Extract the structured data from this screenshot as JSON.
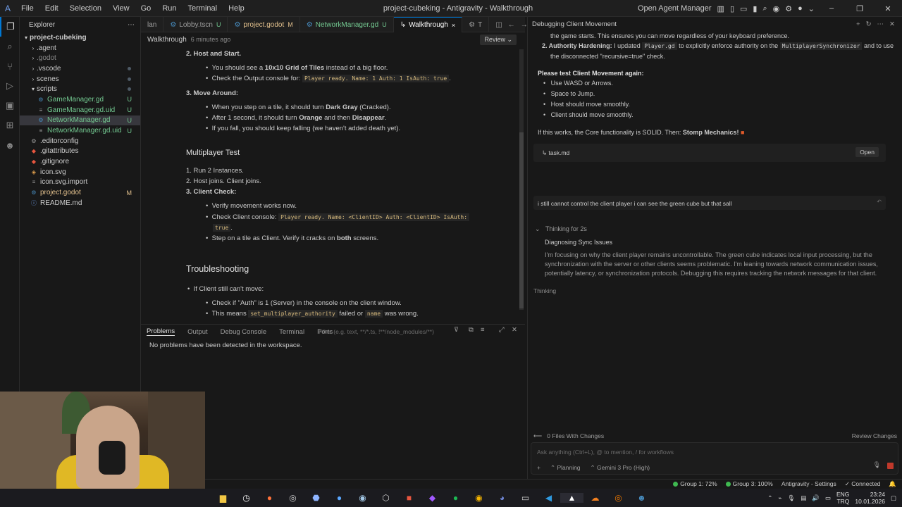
{
  "titlebar": {
    "menu": [
      "File",
      "Edit",
      "Selection",
      "View",
      "Go",
      "Run",
      "Terminal",
      "Help"
    ],
    "window_title": "project-cubeking - Antigravity - Walkthrough",
    "open_agent_manager": "Open Agent Manager"
  },
  "explorer": {
    "title": "Explorer",
    "root": "project-cubeking",
    "items": [
      {
        "name": ".agent",
        "indent": 1,
        "kind": "folder",
        "status": ""
      },
      {
        "name": ".godot",
        "indent": 1,
        "kind": "folder",
        "status": ""
      },
      {
        "name": ".vscode",
        "indent": 1,
        "kind": "folder",
        "status": "dot"
      },
      {
        "name": "scenes",
        "indent": 1,
        "kind": "folder",
        "status": "dot"
      },
      {
        "name": "scripts",
        "indent": 1,
        "kind": "folder-open",
        "status": "dot"
      },
      {
        "name": "GameManager.gd",
        "indent": 2,
        "kind": "gd",
        "status": "U"
      },
      {
        "name": "GameManager.gd.uid",
        "indent": 2,
        "kind": "uid",
        "status": "U"
      },
      {
        "name": "NetworkManager.gd",
        "indent": 2,
        "kind": "gd",
        "status": "U"
      },
      {
        "name": "NetworkManager.gd.uid",
        "indent": 2,
        "kind": "uid",
        "status": "U"
      },
      {
        "name": ".editorconfig",
        "indent": 1,
        "kind": "cfg",
        "status": ""
      },
      {
        "name": ".gitattributes",
        "indent": 1,
        "kind": "git",
        "status": ""
      },
      {
        "name": ".gitignore",
        "indent": 1,
        "kind": "git",
        "status": ""
      },
      {
        "name": "icon.svg",
        "indent": 1,
        "kind": "svg",
        "status": ""
      },
      {
        "name": "icon.svg.import",
        "indent": 1,
        "kind": "uid",
        "status": ""
      },
      {
        "name": "project.godot",
        "indent": 1,
        "kind": "godot",
        "status": "M"
      },
      {
        "name": "README.md",
        "indent": 1,
        "kind": "md",
        "status": ""
      }
    ]
  },
  "tabs": [
    {
      "label": "lan",
      "mark": ""
    },
    {
      "label": "Lobby.tscn",
      "mark": "U"
    },
    {
      "label": "project.godot",
      "mark": "M"
    },
    {
      "label": "NetworkManager.gd",
      "mark": "U"
    },
    {
      "label": "Walkthrough",
      "mark": "×"
    },
    {
      "label": "T",
      "mark": ""
    }
  ],
  "editor": {
    "breadcrumb": "Walkthrough",
    "time": "6 minutes ago",
    "review": "Review",
    "lines": {
      "l1": "2. Host and Start.",
      "l2a": "You should see a ",
      "l2b": "10x10 Grid of Tiles",
      "l2c": " instead of a big floor.",
      "l3a": "Check the Output console for: ",
      "l3code": "Player ready. Name: 1 Auth: 1 IsAuth: true",
      "l4": "3. Move Around:",
      "l5a": "When you step on a tile, it should turn ",
      "l5b": "Dark Gray",
      "l5c": " (Cracked).",
      "l6a": "After 1 second, it should turn ",
      "l6b": "Orange",
      "l6c": " and then ",
      "l6d": "Disappear",
      "l7": "If you fall, you should keep falling (we haven't added death yet).",
      "h_multi": "Multiplayer Test",
      "m1": "1. Run 2 Instances.",
      "m2": "2. Host joins. Client joins.",
      "m3": "3. Client Check:",
      "m4": "Verify movement works now.",
      "m5a": "Check Client console: ",
      "m5code": "Player ready. Name: <ClientID> Auth: <ClientID> IsAuth:",
      "m5code2": "true",
      "m6a": "Step on a tile as Client. Verify it cracks on ",
      "m6b": "both",
      "m6c": " screens.",
      "h_trouble": "Troubleshooting",
      "t1": "If Client still can't move:",
      "t2": "Check if \"Auth\" is 1 (Server) in the console on the client window.",
      "t3a": "This means ",
      "t3code": "set_multiplayer_authority",
      "t3b": " failed or ",
      "t3code2": "name",
      "t3c": " was wrong."
    }
  },
  "panel": {
    "tabs": [
      "Problems",
      "Output",
      "Debug Console",
      "Terminal",
      "Ports"
    ],
    "filter_placeholder": "Filter (e.g. text, **/*.ts, !**/node_modules/**)",
    "message": "No problems have been detected in the workspace."
  },
  "agent": {
    "title": "Debugging Client Movement",
    "c1": "the game starts. This ensures you can move regardless of your keyboard preference.",
    "c2a": "2.  Authority Hardening:",
    "c2b": " I updated ",
    "c2code": "Player.gd",
    "c2c": " to explicitly enforce authority on the ",
    "c2code2": "MultiplayerSynchronizer",
    "c2d": " and to use",
    "c3": "the disconnected \"recursive=true\" check.",
    "c4": "Please test Client Movement again:",
    "b1": "Use WASD or Arrows.",
    "b2": "Space to Jump.",
    "b3": "Host should move smoothly.",
    "b4": "Client should move smoothly.",
    "c5a": "If this works, the Core functionality is SOLID. Then: ",
    "c5b": "Stomp Mechanics!",
    "file": "task.md",
    "open": "Open",
    "user_msg": "i still cannot control the client player i can see the green cube but that sall",
    "thinking_for": "Thinking for 2s",
    "think_title": "Diagnosing Sync Issues",
    "think_body1": "I'm focusing on why the client player remains uncontrollable. The green cube indicates local input processing, but the",
    "think_body2": "synchronization with the server or other clients seems problematic. I'm leaning towards network communication issues,",
    "think_body3": "potentially latency, or synchronization protocols. Debugging this requires tracking the network messages for that client.",
    "thinking": "Thinking",
    "files_changes": "0 Files With Changes",
    "review_changes": "Review Changes",
    "input_placeholder": "Ask anything (Ctrl+L), @ to mention, / for workflows",
    "planning": "Planning",
    "model": "Gemini 3 Pro (High)"
  },
  "status": {
    "group1": "Group 1: 72%",
    "group3": "Group 3: 100%",
    "settings": "Antigravity - Settings",
    "connected": "Connected"
  },
  "taskbar": {
    "lang1": "ENG",
    "lang2": "TRQ",
    "time": "23:24",
    "date": "10.01.2026"
  },
  "colors": {
    "accent": "#0078d4",
    "untracked": "#73c991",
    "modified": "#e2c08d"
  }
}
